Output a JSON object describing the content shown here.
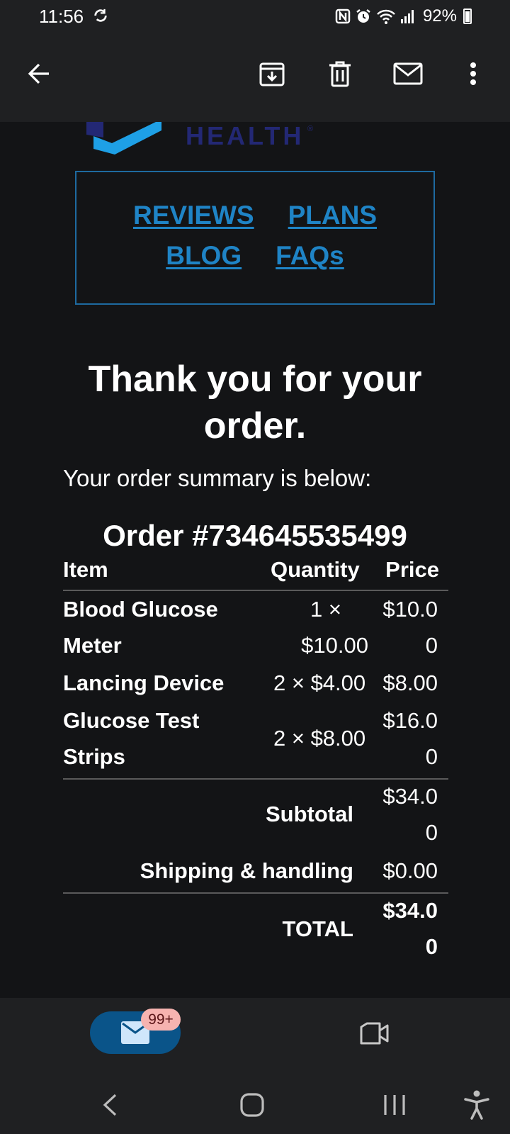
{
  "status_bar": {
    "time": "11:56",
    "battery": "92%",
    "icons": [
      "sync-icon",
      "nfc-icon",
      "alarm-icon",
      "wifi-icon",
      "signal-icon",
      "battery-icon"
    ]
  },
  "app_bar": {
    "icons": [
      "back-arrow-icon",
      "archive-icon",
      "trash-icon",
      "mail-icon",
      "more-vert-icon"
    ]
  },
  "email": {
    "brand_word": "HEALTH",
    "brand_reg": "®",
    "brand_colors": {
      "logo_blue": "#1ea0e6",
      "logo_navy": "#232874",
      "link": "#1f84c6"
    },
    "nav_links": [
      "REVIEWS",
      "PLANS",
      "BLOG",
      "FAQs"
    ],
    "heading": "Thank you for your order.",
    "summary": "Your order summary is below:",
    "order_number": "Order #734645535499",
    "table": {
      "headers": [
        "Item",
        "Quantity",
        "Price"
      ],
      "rows": [
        {
          "item_line1": "Blood Glucose",
          "item_line2": "Meter",
          "qty_line1": "1 ×",
          "qty_line2": "$10.00",
          "price_line1": "$10.0",
          "price_line2": "0"
        },
        {
          "item": "Lancing Device",
          "qty": "2 × $4.00",
          "price": "$8.00"
        },
        {
          "item_line1": "Glucose Test",
          "item_line2": "Strips",
          "qty": "2 × $8.00",
          "price_line1": "$16.0",
          "price_line2": "0"
        }
      ],
      "subtotal_label": "Subtotal",
      "subtotal_line1": "$34.0",
      "subtotal_line2": "0",
      "shipping_label": "Shipping & handling",
      "shipping_value": "$0.00",
      "total_label": "TOTAL",
      "total_line1": "$34.0",
      "total_line2": "0"
    }
  },
  "bottom_nav": {
    "mail_badge": "99+",
    "icons": [
      "mail-icon",
      "video-icon"
    ]
  },
  "system_nav": {
    "icons": [
      "back-icon",
      "home-icon",
      "recents-icon",
      "accessibility-icon"
    ]
  }
}
